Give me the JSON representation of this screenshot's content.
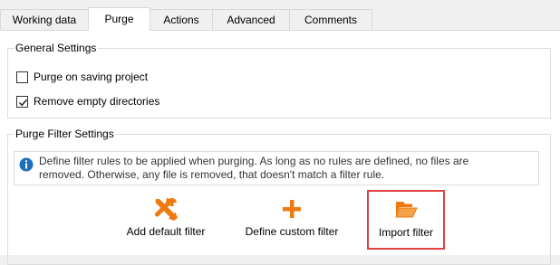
{
  "tabs": [
    {
      "label": "Working data",
      "active": false
    },
    {
      "label": "Purge",
      "active": true
    },
    {
      "label": "Actions",
      "active": false
    },
    {
      "label": "Advanced",
      "active": false
    },
    {
      "label": "Comments",
      "active": false
    }
  ],
  "general_settings": {
    "title": "General Settings",
    "options": [
      {
        "label": "Purge on saving project",
        "checked": false
      },
      {
        "label": "Remove empty directories",
        "checked": true
      }
    ]
  },
  "purge_filter_settings": {
    "title": "Purge Filter Settings",
    "info_line1": "Define filter rules to be applied when purging. As long as no rules are defined, no files are",
    "info_line2": "removed. Otherwise, any file is removed, that doesn't match a filter rule.",
    "actions": [
      {
        "label": "Add default filter",
        "icon": "wrench-screwdriver-icon"
      },
      {
        "label": "Define custom filter",
        "icon": "plus-icon"
      },
      {
        "label": "Import filter",
        "icon": "folder-open-icon",
        "highlighted": true
      }
    ]
  },
  "colors": {
    "accent_orange": "#f07a12",
    "info_blue": "#1f6fbf",
    "highlight_red": "#e04040"
  }
}
